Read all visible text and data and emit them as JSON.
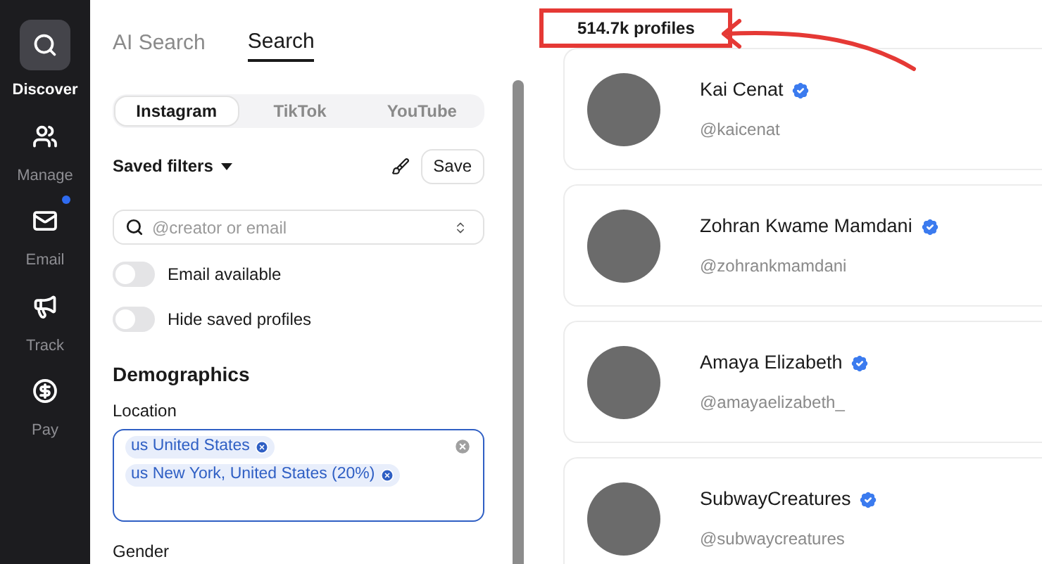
{
  "nav": [
    {
      "label": "Discover",
      "selected": true,
      "badge": false
    },
    {
      "label": "Manage",
      "selected": false,
      "badge": false
    },
    {
      "label": "Email",
      "selected": false,
      "badge": true
    },
    {
      "label": "Track",
      "selected": false,
      "badge": false
    },
    {
      "label": "Pay",
      "selected": false,
      "badge": false
    }
  ],
  "search_tabs": [
    {
      "label": "AI Search",
      "selected": false
    },
    {
      "label": "Search",
      "selected": true
    }
  ],
  "platforms": [
    {
      "label": "Instagram",
      "selected": true
    },
    {
      "label": "TikTok",
      "selected": false
    },
    {
      "label": "YouTube",
      "selected": false
    }
  ],
  "saved_filters": {
    "label": "Saved filters",
    "save_button": "Save"
  },
  "search": {
    "placeholder": "@creator or email"
  },
  "toggles": [
    {
      "label": "Email available",
      "on": false
    },
    {
      "label": "Hide saved profiles",
      "on": false
    }
  ],
  "demographics": {
    "title": "Demographics",
    "location_label": "Location",
    "locations": [
      "us United States",
      "us New York, United States (20%)"
    ],
    "gender_label": "Gender"
  },
  "results": {
    "count": "514.7k profiles",
    "profiles": [
      {
        "name": "Kai Cenat",
        "handle": "@kaicenat",
        "verified": true
      },
      {
        "name": "Zohran Kwame Mamdani",
        "handle": "@zohrankmamdani",
        "verified": true
      },
      {
        "name": "Amaya Elizabeth",
        "handle": "@amayaelizabeth_",
        "verified": true
      },
      {
        "name": "SubwayCreatures",
        "handle": "@subwaycreatures",
        "verified": true
      }
    ]
  }
}
